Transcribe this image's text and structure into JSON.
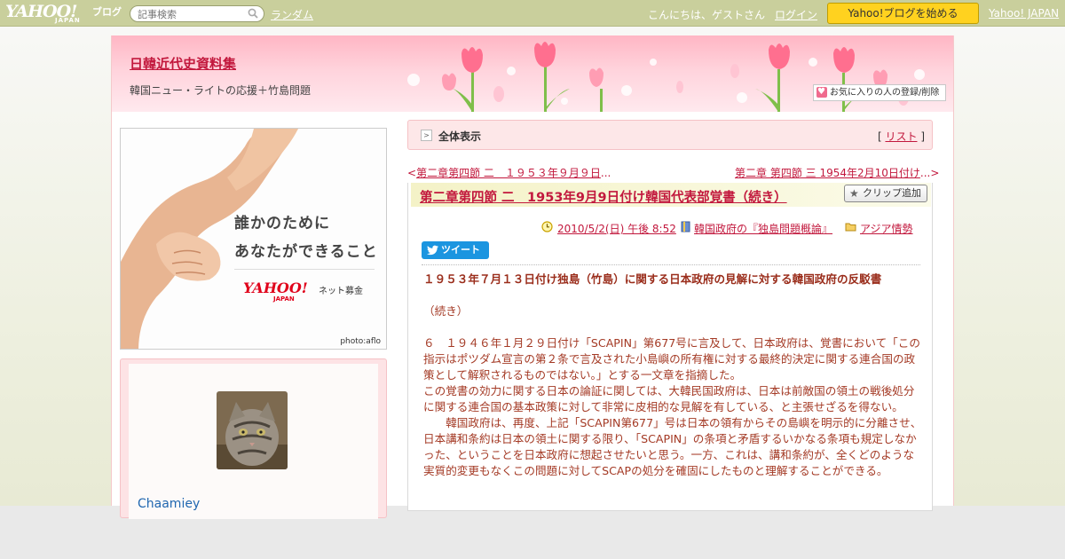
{
  "topbar": {
    "logo_main": "YAHOO!",
    "logo_sub": "JAPAN",
    "logo_blog": "ブログ",
    "search_placeholder": "記事検索",
    "random_link": "ランダム",
    "greeting": "こんにちは、ゲストさん",
    "login_link": "ログイン",
    "start_button": "Yahoo!ブログを始める",
    "yahoo_japan_link": "Yahoo! JAPAN"
  },
  "header": {
    "blog_title": "日韓近代史資料集",
    "blog_description": "韓国ニュー・ライトの応援＋竹島問題",
    "fav_button": "お気に入りの人の登録/削除"
  },
  "banner": {
    "line1": "誰かのために",
    "line2": "あなたができること",
    "logo": "YAHOO!",
    "logo_jp": "JAPAN",
    "logo_sub": "ネット募金",
    "credit": "photo:aflo"
  },
  "profile": {
    "name": "Chaamiey"
  },
  "nav": {
    "all_view_label": "全体表示",
    "list_bracket_open": "[",
    "list_link": "リスト",
    "list_bracket_close": "]",
    "prev_arrow": "<",
    "prev_link": "第二章第四節 二　１９５３年９月９日",
    "prev_ellipsis": "...",
    "next_link": "第二章 第四節 三 1954年2月10日付け",
    "next_ellipsis": "...",
    "next_arrow": ">"
  },
  "article": {
    "title": "第二章第四節 二　1953年9月9日付け韓国代表部覚書（続き）",
    "clip_button": "クリップ追加",
    "date": "2010/5/2(日) 午後 8:52",
    "category": "韓国政府の『独島問題概論』",
    "folder": "アジア情勢",
    "tweet_button": "ツイート",
    "heading": "１９５３年７月１３日付け独島（竹島）に関する日本政府の見解に対する韓国政府の反駁書",
    "continued": "（続き）",
    "para1": "６　１９４６年１月２９日付け「SCAPIN」第677号に言及して、日本政府は、覚書において「この指示はポツダム宣言の第２条で言及された小島嶼の所有権に対する最終的決定に関する連合国の政策として解釈されるものではない。」とする一文章を指摘した。",
    "para2": "この覚書の効力に関する日本の論証に関しては、大韓民国政府は、日本は前敵国の領土の戦後処分に関する連合国の基本政策に対して非常に皮相的な見解を有している、と主張せざるを得ない。",
    "para3": "韓国政府は、再度、上記「SCAPIN第677」号は日本の領有からその島嶼を明示的に分離させ、日本講和条約は日本の領土に関する限り、「SCAPIN」の条項と矛盾するいかなる条項も規定しなかった、ということを日本政府に想起させたいと思う。一方、これは、講和条約が、全くどのような実質的変更もなくこの問題に対してSCAPの処分を確固にしたものと理解することができる。"
  },
  "colors": {
    "topbar": "#c9cf9c",
    "accent_link": "#c2183d",
    "body_text": "#a43a25",
    "start_button": "#ffd21f",
    "tweet_button": "#1b95e0"
  }
}
